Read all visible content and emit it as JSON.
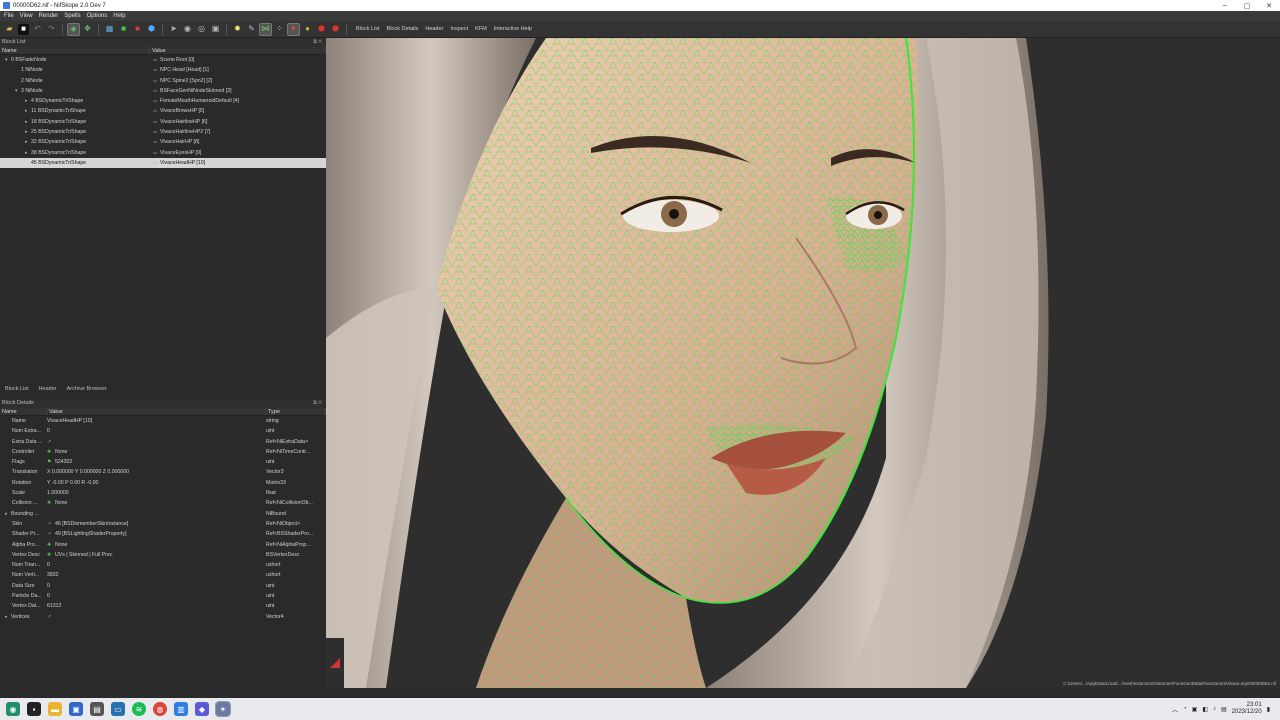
{
  "window": {
    "title": "00000D62.nif - NifSkope 2.0 Dev 7",
    "controls": [
      "–",
      "▢",
      "✕"
    ]
  },
  "menu": [
    "File",
    "View",
    "Render",
    "Spells",
    "Options",
    "Help"
  ],
  "toolbar": {
    "labels": [
      "Block List",
      "Block Details",
      "Header",
      "Inspect",
      "KFM",
      "Interactive Help"
    ]
  },
  "block_list": {
    "title": "Block List",
    "columns": [
      "Name",
      "Value"
    ],
    "rows": [
      {
        "arrow": "▾",
        "indent": 0,
        "name": "0 BSFadeNode",
        "value": "Scene Root [0]"
      },
      {
        "arrow": "",
        "indent": 1,
        "name": "1 NiNode",
        "value": "NPC Head [Head] [1]"
      },
      {
        "arrow": "",
        "indent": 1,
        "name": "2 NiNode",
        "value": "NPC Spine2 [Spn2] [2]"
      },
      {
        "arrow": "▾",
        "indent": 1,
        "name": "3 NiNode",
        "value": "BSFaceGenNiNodeSkinned [3]"
      },
      {
        "arrow": "▸",
        "indent": 2,
        "name": "4 BSDynamicTriShape",
        "value": "FemaleMouthHumanoidDefault [4]"
      },
      {
        "arrow": "▸",
        "indent": 2,
        "name": "11 BSDynamicTriShape",
        "value": "VivaceBrowsHP [5]"
      },
      {
        "arrow": "▸",
        "indent": 2,
        "name": "18 BSDynamicTriShape",
        "value": "VivaceHairlineHP [6]"
      },
      {
        "arrow": "▸",
        "indent": 2,
        "name": "25 BSDynamicTriShape",
        "value": "VivaceHairlineHP2 [7]"
      },
      {
        "arrow": "▸",
        "indent": 2,
        "name": "32 BSDynamicTriShape",
        "value": "VivaceHairHP [8]"
      },
      {
        "arrow": "▸",
        "indent": 2,
        "name": "38 BSDynamicTriShape",
        "value": "VivaceEyesHP [9]"
      },
      {
        "arrow": "",
        "indent": 2,
        "name": "45 BSDynamicTriShape",
        "value": "VivaceHeadHP [10]",
        "selected": true
      }
    ],
    "tabs": [
      "Block List",
      "Header",
      "Archive Browser"
    ]
  },
  "block_details": {
    "title": "Block Details",
    "columns": [
      "Name",
      "Value",
      "Type"
    ],
    "rows": [
      {
        "name": "Name",
        "value": "VivaceHeadHP [10]",
        "type": "string"
      },
      {
        "name": "Num Extra...",
        "value": "0",
        "type": "uint"
      },
      {
        "name": "Extra Data ...",
        "value": "",
        "type": "Ref<NiExtraData>",
        "icon": "↗"
      },
      {
        "name": "Controller",
        "value": "None",
        "type": "Ref<NiTimeContr...",
        "icon": "✚"
      },
      {
        "name": "Flags",
        "value": "524302",
        "type": "uint",
        "icon": "⚑"
      },
      {
        "name": "Translation",
        "value": "X 0.000000 Y 0.000000 Z 0.000000",
        "type": "Vector3"
      },
      {
        "name": "Rotation",
        "value": "Y -0.00 P 0.00 R -0.00",
        "type": "Matrix33"
      },
      {
        "name": "Scale",
        "value": "1.000000",
        "type": "float"
      },
      {
        "name": "Collision ...",
        "value": "None",
        "type": "Ref<NiCollisionOb...",
        "icon": "✚"
      },
      {
        "name": "Bounding ...",
        "value": "",
        "type": "NiBound",
        "arrow": "▸"
      },
      {
        "name": "Skin",
        "value": "46 [BSDismemberSkinInstance]",
        "type": "Ref<NiObject>",
        "icon": "↗"
      },
      {
        "name": "Shader Pr...",
        "value": "49 [BSLightingShaderProperty]",
        "type": "Ref<BSShaderPro...",
        "icon": "↗"
      },
      {
        "name": "Alpha Pro...",
        "value": "None",
        "type": "Ref<NiAlphaProp...",
        "icon": "✚"
      },
      {
        "name": "Vertex Desc",
        "value": "UVs | Skinned | Full Prec",
        "type": "BSVertexDesc",
        "icon": "✚"
      },
      {
        "name": "Num Trian...",
        "value": "0",
        "type": "ushort"
      },
      {
        "name": "Num Verti...",
        "value": "3832",
        "type": "ushort"
      },
      {
        "name": "Data Size",
        "value": "0",
        "type": "uint"
      },
      {
        "name": "Particle Da...",
        "value": "0",
        "type": "uint"
      },
      {
        "name": "Vertex Dat...",
        "value": "61312",
        "type": "uint"
      },
      {
        "name": "Vertices",
        "value": "",
        "type": "Vector4",
        "arrow": "▸",
        "icon": "↗"
      }
    ]
  },
  "viewport": {
    "status_path": "C:/Users/.../AppData/Local/.../meshes/actors/character/FaceGenData/FaceGeom/Vivace.esp/00000D62.nif"
  },
  "taskbar": {
    "icons": [
      "start-icon",
      "search-icon",
      "file-explorer-icon",
      "app-icon",
      "app-icon-2",
      "app-icon-3",
      "spotify-icon",
      "chrome-icon",
      "app-icon-4",
      "app-icon-5",
      "nifskope-icon"
    ],
    "clock_time": "23:01",
    "clock_date": "2023/12/20"
  },
  "colors": {
    "wire": "#39e639",
    "skin": "#e0b9a0",
    "hair": "#b8aca0"
  }
}
